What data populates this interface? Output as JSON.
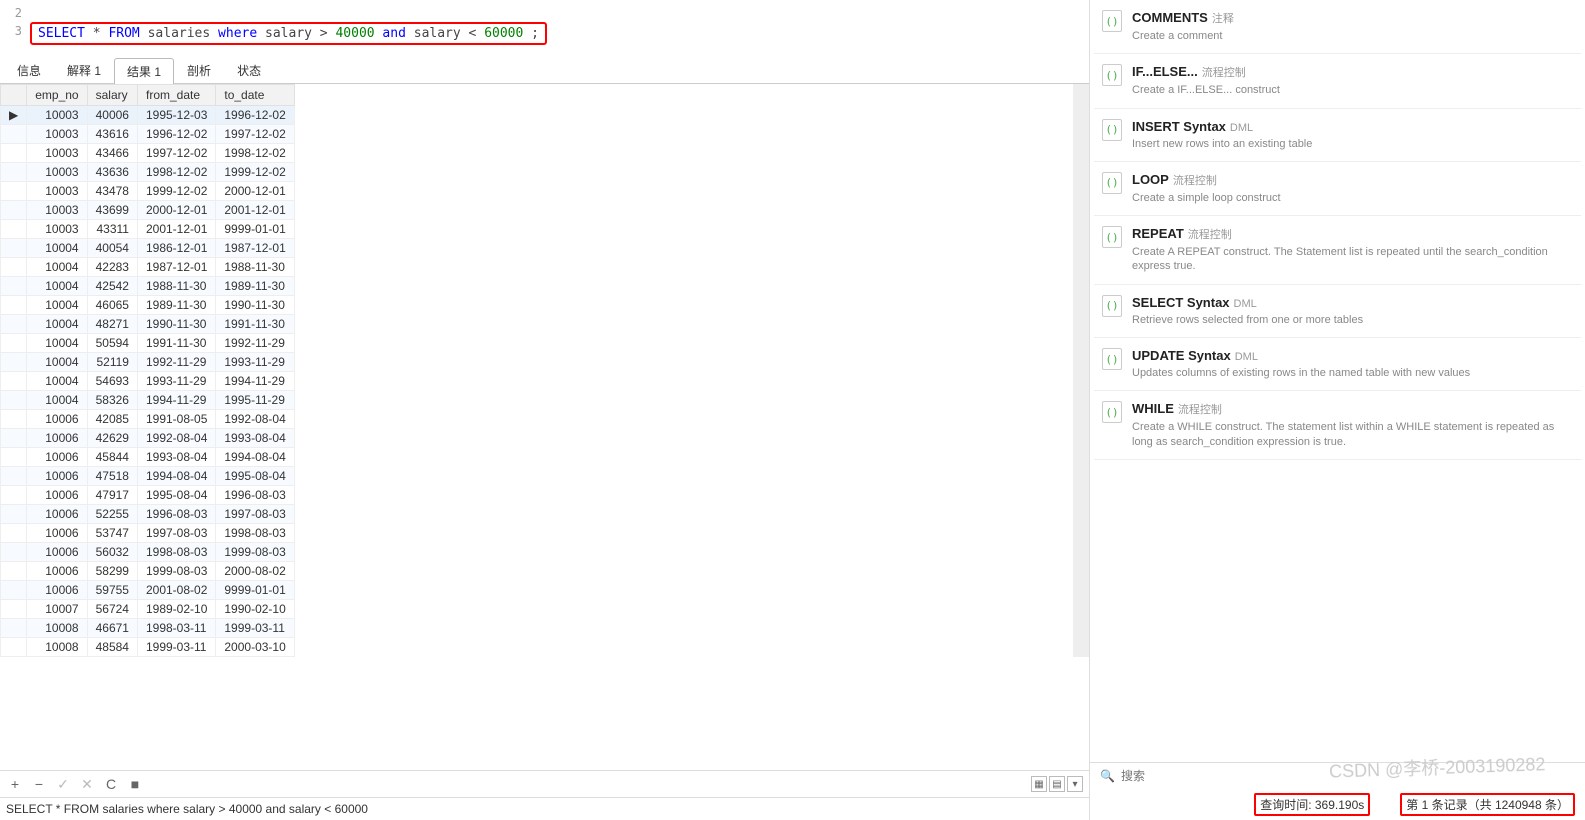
{
  "editor": {
    "line2": "2",
    "line3": "3",
    "sql_select": "SELECT",
    "sql_star": " * ",
    "sql_from": "FROM",
    "sql_table": " salaries ",
    "sql_where": "where",
    "sql_col1": " salary > ",
    "sql_val1": "40000",
    "sql_and": " and",
    "sql_col2": " salary < ",
    "sql_val2": "60000",
    "sql_end": " ;"
  },
  "tabs": [
    "信息",
    "解释 1",
    "结果 1",
    "剖析",
    "状态"
  ],
  "active_tab": 2,
  "columns": [
    "emp_no",
    "salary",
    "from_date",
    "to_date"
  ],
  "rows": [
    [
      "10003",
      "40006",
      "1995-12-03",
      "1996-12-02"
    ],
    [
      "10003",
      "43616",
      "1996-12-02",
      "1997-12-02"
    ],
    [
      "10003",
      "43466",
      "1997-12-02",
      "1998-12-02"
    ],
    [
      "10003",
      "43636",
      "1998-12-02",
      "1999-12-02"
    ],
    [
      "10003",
      "43478",
      "1999-12-02",
      "2000-12-01"
    ],
    [
      "10003",
      "43699",
      "2000-12-01",
      "2001-12-01"
    ],
    [
      "10003",
      "43311",
      "2001-12-01",
      "9999-01-01"
    ],
    [
      "10004",
      "40054",
      "1986-12-01",
      "1987-12-01"
    ],
    [
      "10004",
      "42283",
      "1987-12-01",
      "1988-11-30"
    ],
    [
      "10004",
      "42542",
      "1988-11-30",
      "1989-11-30"
    ],
    [
      "10004",
      "46065",
      "1989-11-30",
      "1990-11-30"
    ],
    [
      "10004",
      "48271",
      "1990-11-30",
      "1991-11-30"
    ],
    [
      "10004",
      "50594",
      "1991-11-30",
      "1992-11-29"
    ],
    [
      "10004",
      "52119",
      "1992-11-29",
      "1993-11-29"
    ],
    [
      "10004",
      "54693",
      "1993-11-29",
      "1994-11-29"
    ],
    [
      "10004",
      "58326",
      "1994-11-29",
      "1995-11-29"
    ],
    [
      "10006",
      "42085",
      "1991-08-05",
      "1992-08-04"
    ],
    [
      "10006",
      "42629",
      "1992-08-04",
      "1993-08-04"
    ],
    [
      "10006",
      "45844",
      "1993-08-04",
      "1994-08-04"
    ],
    [
      "10006",
      "47518",
      "1994-08-04",
      "1995-08-04"
    ],
    [
      "10006",
      "47917",
      "1995-08-04",
      "1996-08-03"
    ],
    [
      "10006",
      "52255",
      "1996-08-03",
      "1997-08-03"
    ],
    [
      "10006",
      "53747",
      "1997-08-03",
      "1998-08-03"
    ],
    [
      "10006",
      "56032",
      "1998-08-03",
      "1999-08-03"
    ],
    [
      "10006",
      "58299",
      "1999-08-03",
      "2000-08-02"
    ],
    [
      "10006",
      "59755",
      "2001-08-02",
      "9999-01-01"
    ],
    [
      "10007",
      "56724",
      "1989-02-10",
      "1990-02-10"
    ],
    [
      "10008",
      "46671",
      "1998-03-11",
      "1999-03-11"
    ],
    [
      "10008",
      "48584",
      "1999-03-11",
      "2000-03-10"
    ]
  ],
  "toolbar": {
    "plus": "+",
    "minus": "−",
    "check": "✓",
    "x": "✕",
    "refresh": "C",
    "stop": "■"
  },
  "status_sql": "SELECT * FROM salaries where salary > 40000 and salary < 60000",
  "snippets": [
    {
      "title": "COMMENTS",
      "tag": "注释",
      "desc": "Create a comment"
    },
    {
      "title": "IF...ELSE...",
      "tag": "流程控制",
      "desc": "Create a IF...ELSE... construct"
    },
    {
      "title": "INSERT Syntax",
      "tag": "DML",
      "desc": "Insert new rows into an existing table"
    },
    {
      "title": "LOOP",
      "tag": "流程控制",
      "desc": "Create a simple loop construct"
    },
    {
      "title": "REPEAT",
      "tag": "流程控制",
      "desc": "Create A REPEAT construct. The Statement list is repeated until the search_condition express true."
    },
    {
      "title": "SELECT Syntax",
      "tag": "DML",
      "desc": "Retrieve rows selected from one or more tables"
    },
    {
      "title": "UPDATE Syntax",
      "tag": "DML",
      "desc": "Updates columns of existing rows in the named table with new values"
    },
    {
      "title": "WHILE",
      "tag": "流程控制",
      "desc": "Create a WHILE construct. The statement list within a WHILE statement is repeated as long as search_condition expression is true."
    }
  ],
  "search_placeholder": "搜索",
  "query_time_label": "查询时间: 369.190s",
  "record_label": "第 1 条记录（共 1240948 条）",
  "watermark": "CSDN @李桥-2003190282"
}
